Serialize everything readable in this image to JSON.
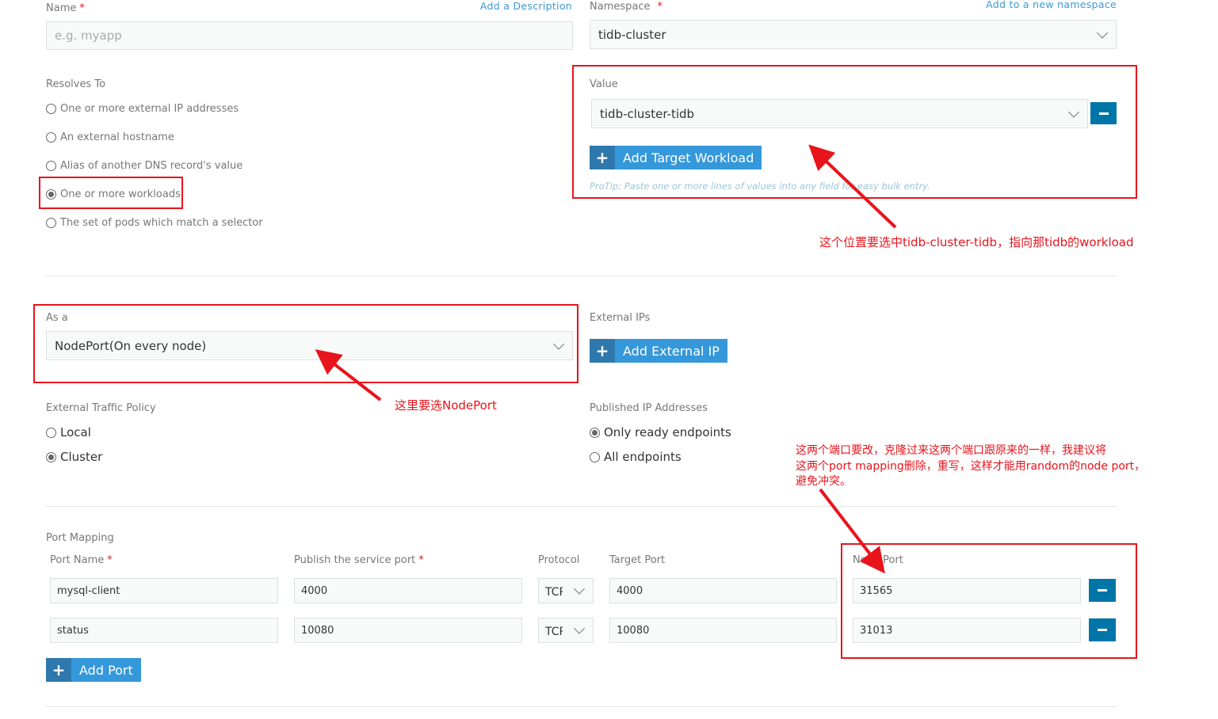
{
  "name": {
    "label": "Name",
    "required": "*",
    "placeholder": "e.g. myapp",
    "add_description": "Add a Description"
  },
  "namespace": {
    "label": "Namespace",
    "required": "*",
    "value": "tidb-cluster",
    "add_new": "Add to a new namespace"
  },
  "resolves_to": {
    "label": "Resolves To",
    "options": [
      "One or more external IP addresses",
      "An external hostname",
      "Alias of another DNS record's value",
      "One or more workloads",
      "The set of pods which match a selector"
    ],
    "selected": 3
  },
  "value": {
    "label": "Value",
    "selected": "tidb-cluster-tidb",
    "add_button": "Add Target Workload",
    "protip": "ProTip: Paste one or more lines of values into any field for easy bulk entry."
  },
  "as_a": {
    "label": "As a",
    "value": "NodePort(On every node)"
  },
  "external_ips": {
    "label": "External IPs",
    "add_button": "Add External IP"
  },
  "traffic_policy": {
    "label": "External Traffic Policy",
    "options": [
      "Local",
      "Cluster"
    ],
    "selected": 1
  },
  "published_ips": {
    "label": "Published IP Addresses",
    "options": [
      "Only ready endpoints",
      "All endpoints"
    ],
    "selected": 0
  },
  "port_mapping": {
    "label": "Port Mapping",
    "headers": {
      "port_name": "Port Name",
      "publish_port": "Publish the service port",
      "protocol": "Protocol",
      "target_port": "Target Port",
      "node_port": "Node Port",
      "required": "*"
    },
    "rows": [
      {
        "name": "mysql-client",
        "publish": "4000",
        "protocol": "TCP",
        "target": "4000",
        "node": "31565"
      },
      {
        "name": "status",
        "publish": "10080",
        "protocol": "TCP",
        "target": "10080",
        "node": "31013"
      }
    ],
    "add_button": "Add Port"
  },
  "annotations": {
    "value_note": "这个位置要选中tidb-cluster-tidb，指向那tidb的workload",
    "nodeport_note": "这里要选NodePort",
    "port_note": [
      "这两个端口要改，克隆过来这两个端口跟原来的一样，我建议将",
      "这两个port mapping删除，重写，这样才能用random的node port，",
      "避免冲突。"
    ]
  },
  "colors": {
    "annotation": "#e8141c",
    "primary": "#3498db",
    "remove": "#0075a8"
  }
}
